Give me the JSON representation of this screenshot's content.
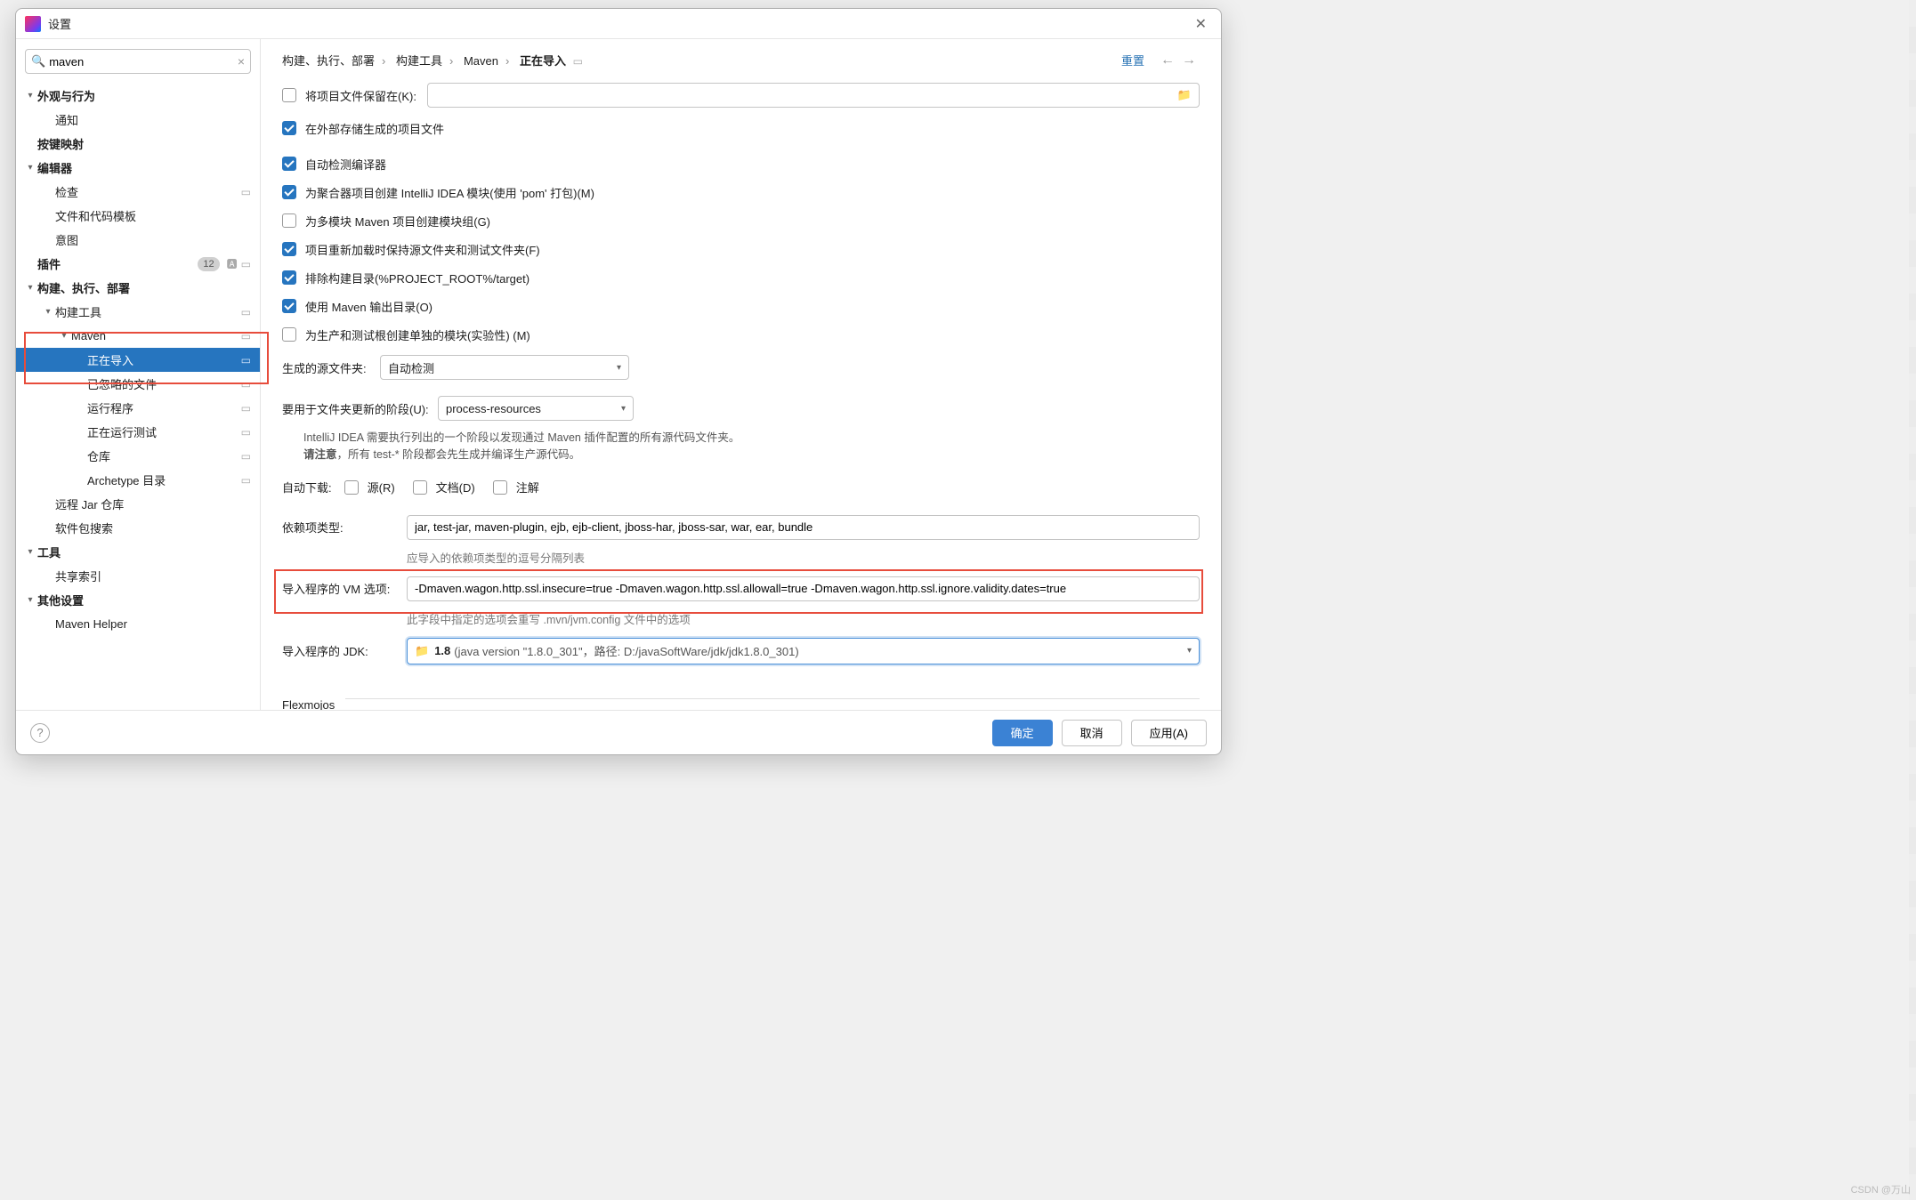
{
  "window": {
    "title": "设置"
  },
  "search": {
    "value": "maven"
  },
  "tree": {
    "appearance": "外观与行为",
    "notifications": "通知",
    "keymap": "按键映射",
    "editor": "编辑器",
    "inspections": "检查",
    "templates": "文件和代码模板",
    "intentions": "意图",
    "plugins": "插件",
    "plugins_count": "12",
    "build": "构建、执行、部署",
    "build_tools": "构建工具",
    "maven": "Maven",
    "importing": "正在导入",
    "ignored": "已忽略的文件",
    "runner": "运行程序",
    "running_tests": "正在运行测试",
    "repos": "仓库",
    "archetype": "Archetype 目录",
    "remote_jar": "远程 Jar 仓库",
    "pkg_search": "软件包搜索",
    "tools": "工具",
    "shared_indexes": "共享索引",
    "other": "其他设置",
    "maven_helper": "Maven Helper"
  },
  "breadcrumb": {
    "a": "构建、执行、部署",
    "b": "构建工具",
    "c": "Maven",
    "d": "正在导入",
    "reset": "重置"
  },
  "form": {
    "keep_files_label": "将项目文件保留在(K):",
    "store_external": "在外部存储生成的项目文件",
    "detect_compiler": "自动检测编译器",
    "create_modules": "为聚合器项目创建 IntelliJ IDEA 模块(使用 'pom' 打包)(M)",
    "create_groups": "为多模块 Maven 项目创建模块组(G)",
    "keep_sources": "项目重新加载时保持源文件夹和测试文件夹(F)",
    "exclude_build": "排除构建目录(%PROJECT_ROOT%/target)",
    "use_output": "使用 Maven 输出目录(O)",
    "separate_modules": "为生产和测试根创建单独的模块(实验性) (M)",
    "gen_sources_label": "生成的源文件夹:",
    "gen_sources_value": "自动检测",
    "phase_label": "要用于文件夹更新的阶段(U):",
    "phase_value": "process-resources",
    "phase_note1": "IntelliJ IDEA 需要执行列出的一个阶段以发现通过 Maven 插件配置的所有源代码文件夹。",
    "phase_note2_a": "请注意",
    "phase_note2_b": "，所有 test-* 阶段都会先生成并编译生产源代码。",
    "auto_dl_label": "自动下载:",
    "auto_dl_src": "源(R)",
    "auto_dl_doc": "文档(D)",
    "auto_dl_ann": "注解",
    "dep_types_label": "依赖项类型:",
    "dep_types_value": "jar, test-jar, maven-plugin, ejb, ejb-client, jboss-har, jboss-sar, war, ear, bundle",
    "dep_types_hint": "应导入的依赖项类型的逗号分隔列表",
    "vm_label": "导入程序的 VM 选项:",
    "vm_value": "-Dmaven.wagon.http.ssl.insecure=true -Dmaven.wagon.http.ssl.allowall=true -Dmaven.wagon.http.ssl.ignore.validity.dates=true",
    "vm_hint": "此字段中指定的选项会重写 .mvn/jvm.config 文件中的选项",
    "jdk_label": "导入程序的 JDK:",
    "jdk_ver": "1.8",
    "jdk_rest": " (java version \"1.8.0_301\"，路径: D:/javaSoftWare/jdk/jdk1.8.0_301)",
    "flexmojos": "Flexmojos"
  },
  "footer": {
    "ok": "确定",
    "cancel": "取消",
    "apply": "应用(A)"
  },
  "watermark": "CSDN @万山"
}
